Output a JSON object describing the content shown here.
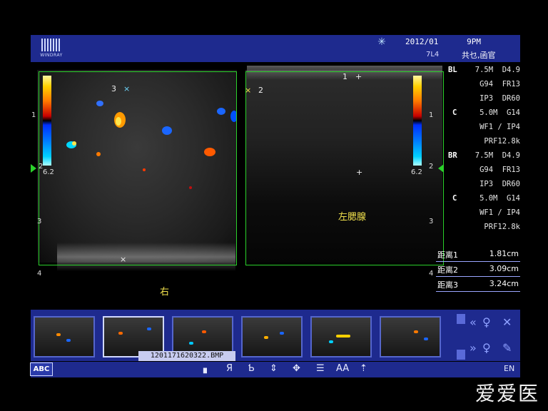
{
  "header": {
    "logo_text": "WINDRAY",
    "datetime": "2012/01      9PM",
    "probe": "7L4",
    "exam": "共乜,函官"
  },
  "image": {
    "left_colorbar_value": "6.2",
    "right_colorbar_value": "6.2",
    "left_marker_3": "3",
    "left_marker_3_sym": "×",
    "right_marker_2": "2",
    "right_marker_1": "1",
    "left_bottom_cross": "×",
    "right_center_cross": "+",
    "left_label": "右",
    "right_label": "左腮腺",
    "depth_left": [
      "1",
      "2",
      "3",
      "4"
    ],
    "depth_right": [
      "1",
      "2",
      "3",
      "4"
    ]
  },
  "params": {
    "BL": {
      "label": "BL",
      "line1": "7.5M  D4.9",
      "line2": "G94  FR13",
      "line3": "IP3  DR60"
    },
    "C1": {
      "label": "C",
      "line1": "5.0M  G14",
      "line2": "WF1 / IP4",
      "line3": "PRF12.8k"
    },
    "BR": {
      "label": "BR",
      "line1": "7.5M  D4.9",
      "line2": "G94  FR13",
      "line3": "IP3  DR60"
    },
    "C2": {
      "label": "C",
      "line1": "5.0M  G14",
      "line2": "WF1 / IP4",
      "line3": "PRF12.8k"
    }
  },
  "measurements": [
    {
      "label": "距离1",
      "value": "1.81cm"
    },
    {
      "label": "距离2",
      "value": "3.09cm"
    },
    {
      "label": "距离3",
      "value": "3.24cm"
    }
  ],
  "thumbnails": {
    "count": 6,
    "tooltip": "1201171620322.BMP"
  },
  "toolbar": {
    "abc_label": "ABC",
    "lang": "EN",
    "icons": [
      "cursor-icon",
      "reverse-r-icon",
      "reverse-b-icon",
      "updown-arrows-icon",
      "grid-arrows-icon",
      "notes-icon",
      "font-size-icon",
      "up-arrow-icon"
    ],
    "glyph_r": "Я",
    "glyph_b": "Ƅ",
    "glyph_font": "AA"
  },
  "side_buttons": {
    "prev": "«",
    "next": "»",
    "close": "✕"
  },
  "watermark": "爱爱医"
}
